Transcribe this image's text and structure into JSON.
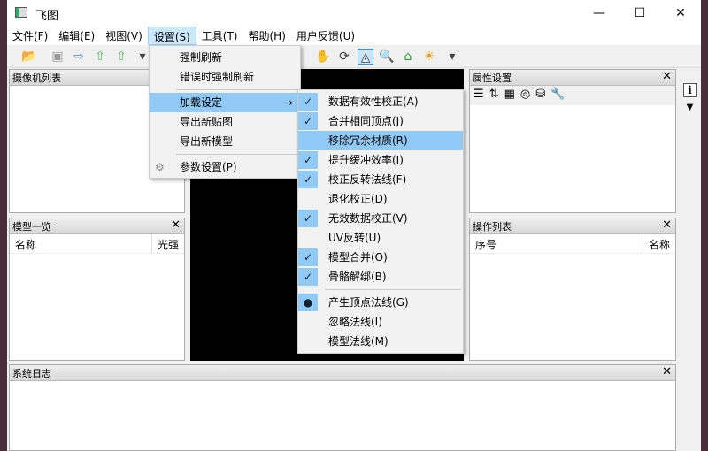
{
  "window": {
    "title": "飞图",
    "minimize": "—",
    "maximize": "☐",
    "close": "✕"
  },
  "menubar": [
    "文件(F)",
    "编辑(E)",
    "视图(V)",
    "设置(S)",
    "工具(T)",
    "帮助(H)",
    "用户反馈(U)"
  ],
  "panels": {
    "camera": {
      "title": "摄像机列表"
    },
    "models": {
      "title": "模型一览",
      "cols": [
        "名称",
        "光强"
      ]
    },
    "props": {
      "title": "属性设置"
    },
    "ops": {
      "title": "操作列表",
      "cols": [
        "序号",
        "名称"
      ]
    },
    "log": {
      "title": "系统日志"
    },
    "close": "✕"
  },
  "settings_menu": [
    {
      "label": "强制刷新"
    },
    {
      "label": "错误时强制刷新"
    },
    {
      "label": "加载设定",
      "submenu": true
    },
    {
      "label": "导出新贴图"
    },
    {
      "label": "导出新模型"
    },
    {
      "label": "参数设置(P)",
      "icon": "gear-icon"
    }
  ],
  "load_submenu": [
    {
      "label": "数据有效性校正(A)",
      "checked": true
    },
    {
      "label": "合并相同顶点(J)",
      "checked": true
    },
    {
      "label": "移除冗余材质(R)",
      "checked": false,
      "highlighted": true
    },
    {
      "label": "提升缓冲效率(I)",
      "checked": true
    },
    {
      "label": "校正反转法线(F)",
      "checked": true
    },
    {
      "label": "退化校正(D)",
      "checked": false
    },
    {
      "label": "无效数据校正(V)",
      "checked": true
    },
    {
      "label": "UV反转(U)",
      "checked": false
    },
    {
      "label": "模型合并(O)",
      "checked": true
    },
    {
      "label": "骨骼解绑(B)",
      "checked": true
    },
    {
      "label": "产生顶点法线(G)",
      "radio": true
    },
    {
      "label": "忽略法线(I)",
      "radio": false
    },
    {
      "label": "模型法线(M)",
      "radio": false
    }
  ],
  "icons": {
    "check": "✓",
    "radio": "●",
    "arrow": "›",
    "gear": "⚙",
    "info": "i"
  }
}
